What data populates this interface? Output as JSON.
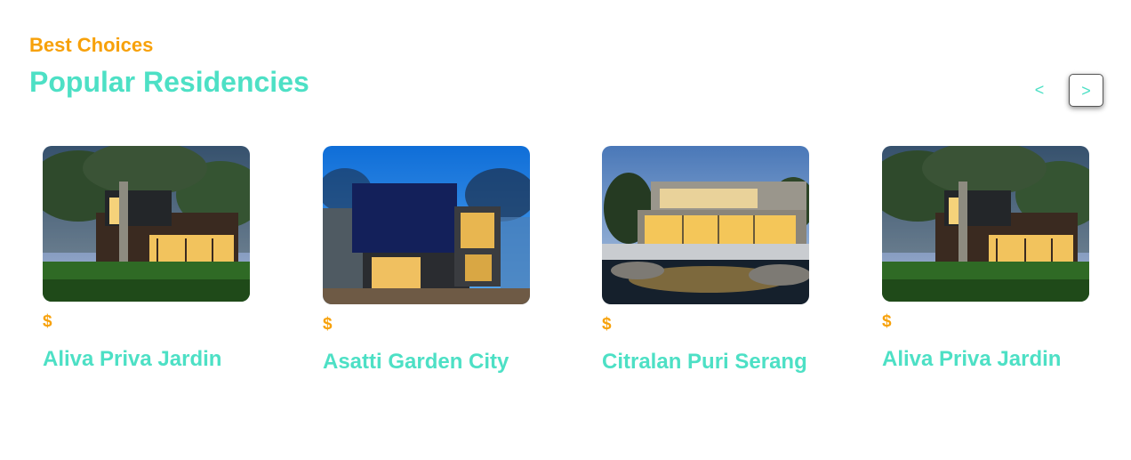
{
  "section": {
    "kicker": "Best Choices",
    "title": "Popular Residencies"
  },
  "carousel_nav": {
    "prev_label": "<",
    "next_label": ">"
  },
  "residencies": [
    {
      "price": "$",
      "name": "Aliva Priva Jardin",
      "image": "modern-house-dusk-with-tree"
    },
    {
      "price": "$",
      "name": "Asatti Garden City",
      "image": "modern-house-night-blue-facade"
    },
    {
      "price": "$",
      "name": "Citralan Puri Serang",
      "image": "modern-villa-with-reflecting-pond"
    },
    {
      "price": "$",
      "name": "Aliva Priva Jardin",
      "image": "modern-house-dusk-with-tree"
    }
  ],
  "colors": {
    "accent_orange": "#f7a10a",
    "accent_teal": "#4de0c5"
  }
}
